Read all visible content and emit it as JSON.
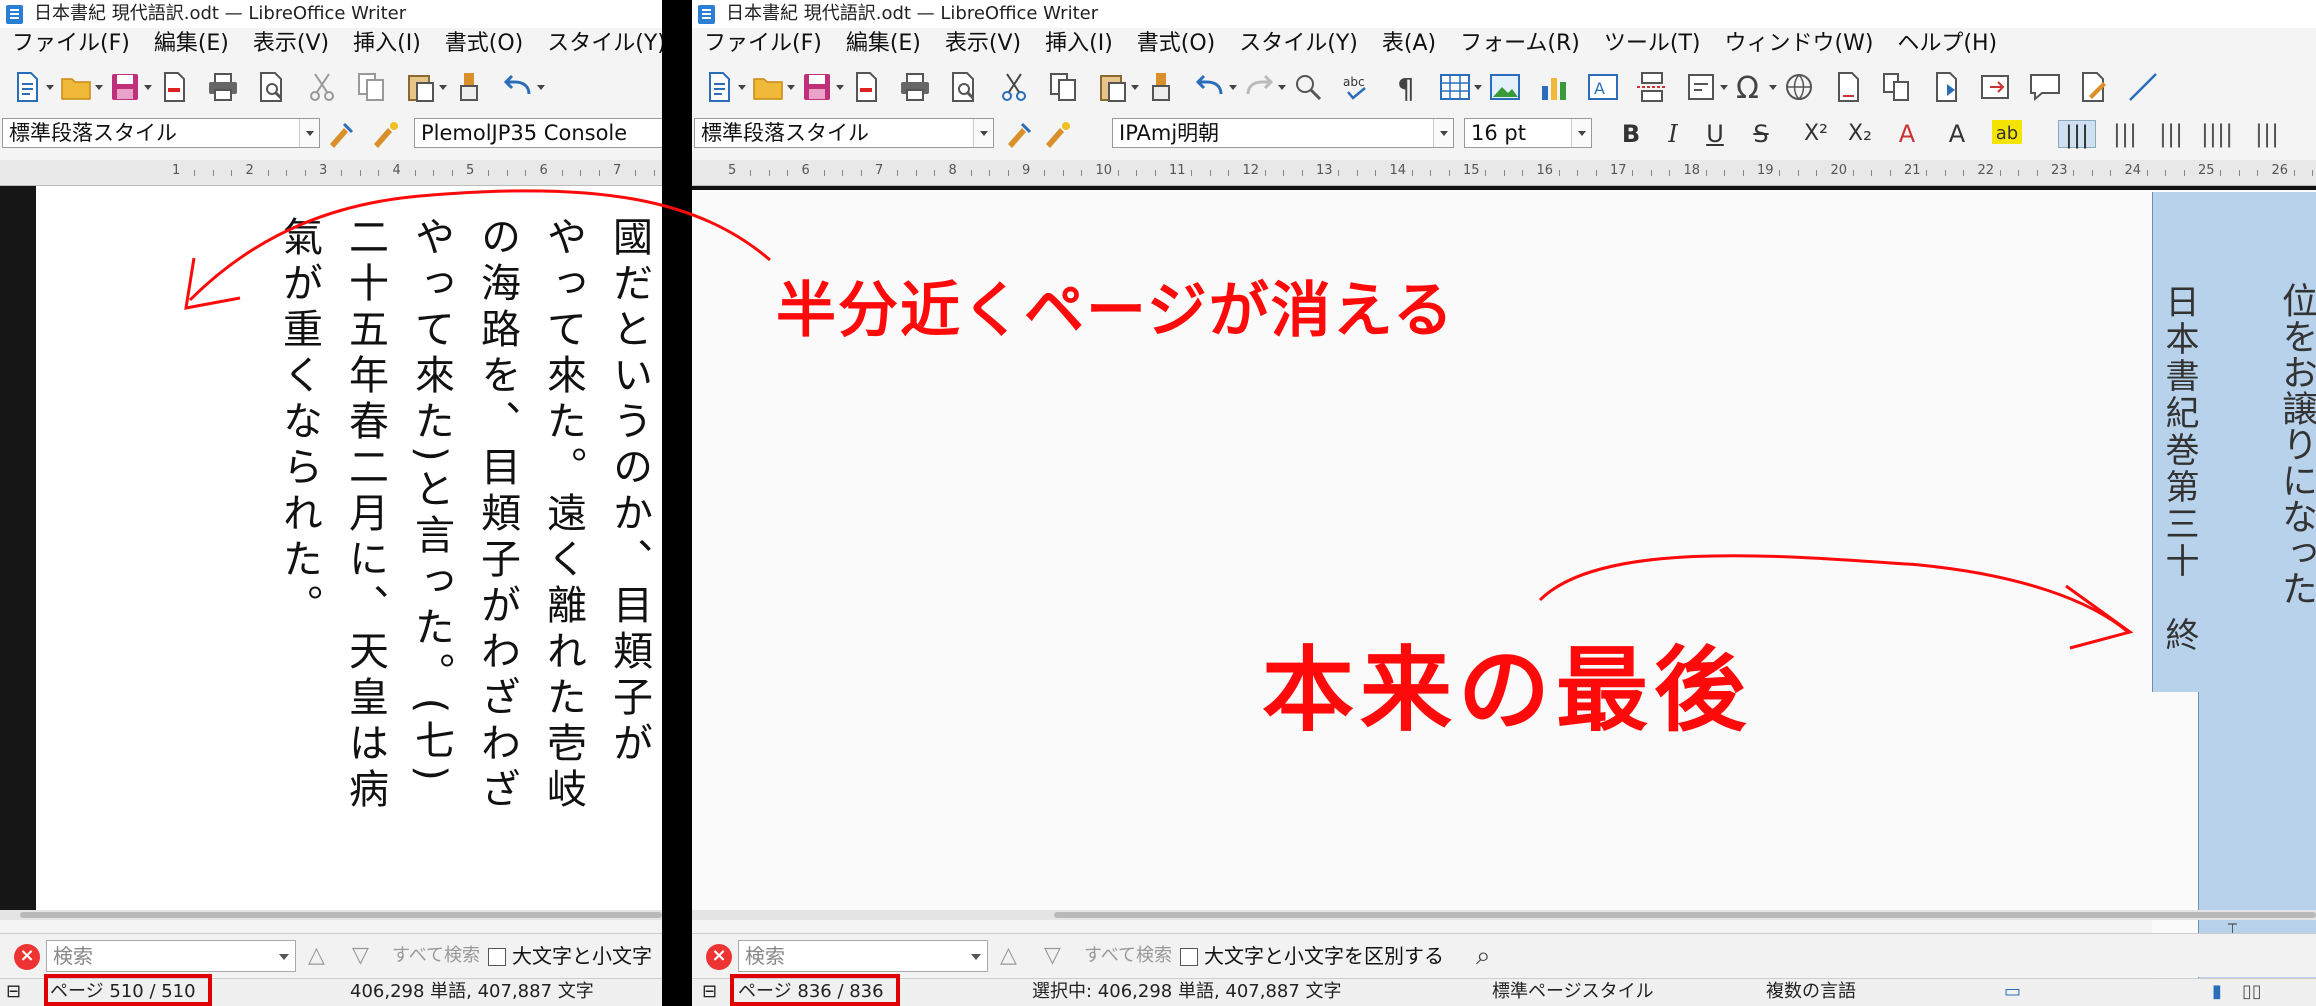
{
  "left_window": {
    "title": "日本書紀 現代語訳.odt — LibreOffice Writer",
    "menu": [
      "ファイル(F)",
      "編集(E)",
      "表示(V)",
      "挿入(I)",
      "書式(O)",
      "スタイル(Y)"
    ],
    "paragraph_style": "標準段落スタイル",
    "font_name": "PlemolJP35 Console",
    "ruler_numbers": [
      "1",
      "2",
      "3",
      "4",
      "5",
      "6",
      "7"
    ],
    "doc_columns": [
      "國だというのか、目頬子が",
      "やって來た。遠く離れた壱岐",
      "の海路を、目頬子がわざわざ",
      "やって來た)と言った。(七)",
      "二十五年春二月に、天皇は病",
      "氣が重くなられた。"
    ],
    "find_bar": {
      "placeholder": "検索",
      "find_all": "すべて検索",
      "match_case": "大文字と小文字"
    },
    "status": {
      "page": "ページ 510 / 510",
      "words": "406,298 単語, 407,887 文字"
    }
  },
  "right_window": {
    "title": "日本書紀 現代語訳.odt — LibreOffice Writer",
    "menu": [
      "ファイル(F)",
      "編集(E)",
      "表示(V)",
      "挿入(I)",
      "書式(O)",
      "スタイル(Y)",
      "表(A)",
      "フォーム(R)",
      "ツール(T)",
      "ウィンドウ(W)",
      "ヘルプ(H)"
    ],
    "paragraph_style": "標準段落スタイル",
    "font_name": "IPAmj明朝",
    "font_size": "16 pt",
    "ruler_numbers": [
      "5",
      "6",
      "7",
      "8",
      "9",
      "10",
      "11",
      "12",
      "13",
      "14",
      "15",
      "16",
      "17",
      "18",
      "19",
      "20",
      "21",
      "22",
      "23",
      "24",
      "25",
      "26"
    ],
    "doc_columns": [
      "位をお譲りになった",
      "日本書紀巻第三十　終"
    ],
    "find_bar": {
      "placeholder": "検索",
      "find_all": "すべて検索",
      "match_case": "大文字と小文字を区別する"
    },
    "status": {
      "page": "ページ 836 / 836",
      "words": "選択中: 406,298 単語, 407,887 文字",
      "page_style": "標準ページスタイル",
      "language": "複数の言語"
    }
  },
  "annotations": {
    "top": "半分近くページが消える",
    "bottom": "本来の最後"
  },
  "colors": {
    "annotation": "#ff0a0a",
    "highlight": "#b7d2ea",
    "status_box": "#e00000"
  }
}
